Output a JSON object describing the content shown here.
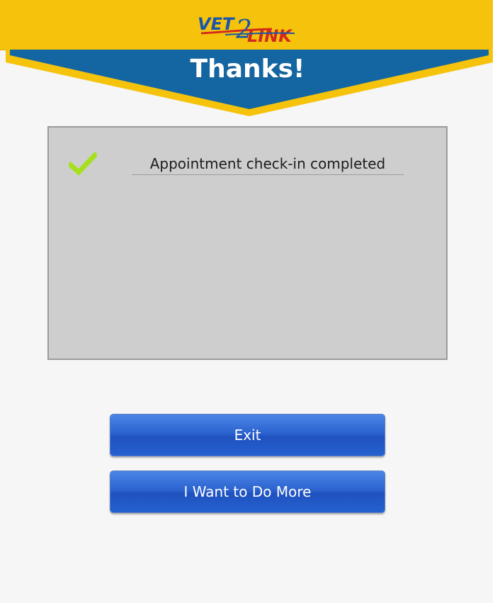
{
  "header": {
    "logo_text_left": "VET",
    "logo_text_right": "LINK",
    "logo_glyph": "2",
    "title": "Thanks!"
  },
  "panel": {
    "status_icon": "check-icon",
    "message": "Appointment check-in completed"
  },
  "actions": {
    "exit_label": "Exit",
    "more_label": "I Want to Do More"
  },
  "colors": {
    "top_bar": "#f5c30c",
    "banner_blue": "#1466a2",
    "banner_border": "#f5c30c",
    "check_green": "#a6e01c",
    "button_blue": "#2c63cf",
    "logo_blue": "#1a56a8",
    "logo_red": "#d22a1c"
  }
}
